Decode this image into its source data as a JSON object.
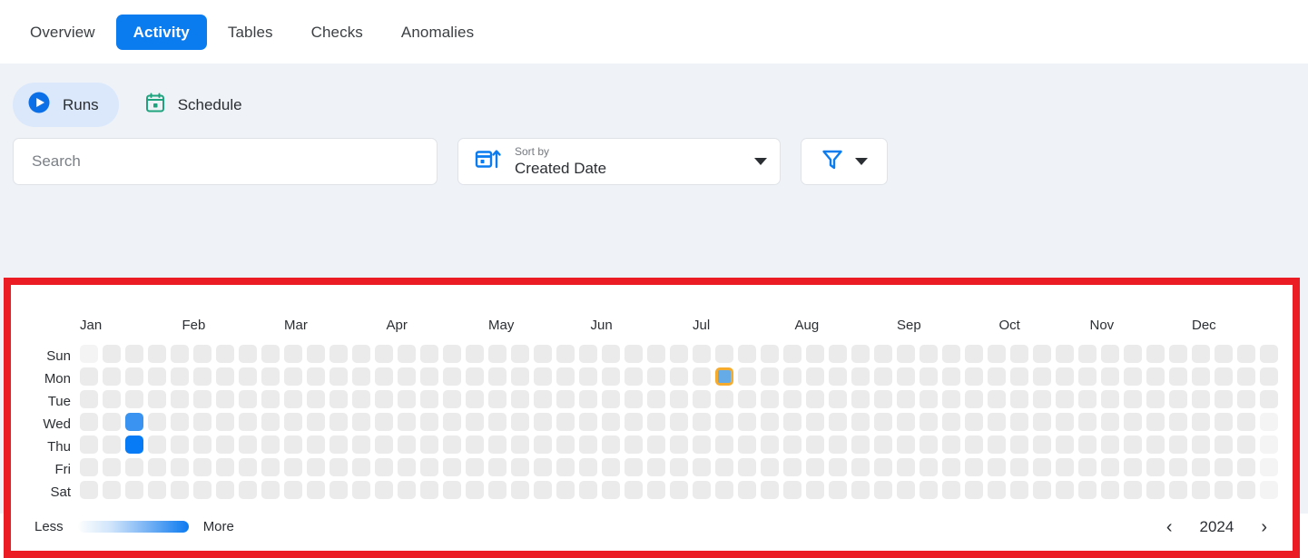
{
  "tabs": [
    {
      "label": "Overview",
      "active": false
    },
    {
      "label": "Activity",
      "active": true
    },
    {
      "label": "Tables",
      "active": false
    },
    {
      "label": "Checks",
      "active": false
    },
    {
      "label": "Anomalies",
      "active": false
    }
  ],
  "modes": [
    {
      "label": "Runs",
      "icon": "play-circle-icon",
      "active": true
    },
    {
      "label": "Schedule",
      "icon": "calendar-icon",
      "active": false
    }
  ],
  "search": {
    "value": "",
    "placeholder": "Search"
  },
  "sort": {
    "icon": "calendar-sort-ascending-icon",
    "label": "Sort by",
    "value": "Created Date"
  },
  "filter": {
    "icon": "funnel-icon",
    "label": ""
  },
  "heatmap": {
    "months": [
      "Jan",
      "Feb",
      "Mar",
      "Apr",
      "May",
      "Jun",
      "Jul",
      "Aug",
      "Sep",
      "Oct",
      "Nov",
      "Dec"
    ],
    "days": [
      "Sun",
      "Mon",
      "Tue",
      "Wed",
      "Thu",
      "Fri",
      "Sat"
    ],
    "legend_less": "Less",
    "legend_more": "More",
    "year": "2024",
    "prev_label": "‹",
    "next_label": "›",
    "colors": {
      "empty": "#ebebeb",
      "dim": "#f4f4f4",
      "low": "#3a93f0",
      "high": "#067bf5",
      "selected_fill": "#64abe8",
      "selected_border": "#f5ab2e",
      "accent": "#0b7bf0"
    }
  },
  "chart_data": {
    "type": "heatmap",
    "title": "",
    "xlabel": "",
    "ylabel": "",
    "year": "2024",
    "weeks": 53,
    "rows": 7,
    "categories_x": [
      "Jan",
      "Feb",
      "Mar",
      "Apr",
      "May",
      "Jun",
      "Jul",
      "Aug",
      "Sep",
      "Oct",
      "Nov",
      "Dec"
    ],
    "categories_y": [
      "Sun",
      "Mon",
      "Tue",
      "Wed",
      "Thu",
      "Fri",
      "Sat"
    ],
    "legend": {
      "low": "Less",
      "high": "More",
      "position": "bottom-left"
    },
    "points": [
      {
        "week": 2,
        "day": 3,
        "day_label": "Wed",
        "month": "Jan",
        "value": 2,
        "color": "#3a93f0",
        "state": "filled"
      },
      {
        "week": 2,
        "day": 4,
        "day_label": "Thu",
        "month": "Jan",
        "value": 3,
        "color": "#067bf5",
        "state": "filled"
      },
      {
        "week": 28,
        "day": 1,
        "day_label": "Mon",
        "month": "Jul",
        "value": 1,
        "color": "#64abe8",
        "state": "selected"
      }
    ],
    "empty_cells_note": "all other cells have value 0",
    "dim_cells_note": "trailing cells after the last recorded date are rendered lighter"
  }
}
